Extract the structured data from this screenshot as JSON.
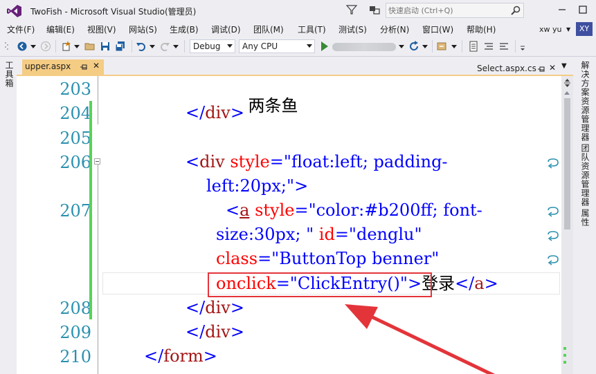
{
  "window": {
    "title": "TwoFish - Microsoft Visual Studio(管理员)",
    "quick_launch_placeholder": "快速启动 (Ctrl+Q)",
    "user": "xw yu",
    "avatar": "XY"
  },
  "menu": [
    "文件(F)",
    "编辑(E)",
    "视图(V)",
    "网站(S)",
    "生成(B)",
    "调试(D)",
    "团队(M)",
    "工具(T)",
    "测试(S)",
    "分析(N)",
    "窗口(W)",
    "帮助(H)"
  ],
  "toolbar": {
    "config": "Debug",
    "platform": "Any CPU"
  },
  "left_panel": {
    "toolbox_label": "工具箱"
  },
  "right_panel": [
    "解决方案资源管理器",
    "团队资源管理器",
    "属性"
  ],
  "tabs": {
    "active": "upper.aspx",
    "preview": "Select.aspx.cs"
  },
  "editor": {
    "line_numbers": [
      "203",
      "204",
      "205",
      "206",
      "207",
      "208",
      "209",
      "210"
    ],
    "code": {
      "l203": "两条鱼",
      "l204_open": "</",
      "l204_tag": "div",
      "l204_close": ">",
      "l206_open": "<",
      "l206_tag": "div",
      "l206_attr": "style",
      "l206_eq": "=",
      "l206_val": "\"float:left; padding-",
      "l206b_val": "left:20px;\"",
      "l206b_close": ">",
      "l207_open": "<",
      "l207_tag": "a",
      "l207_attr": "style",
      "l207_eq": "=",
      "l207_val": "\"color:#b200ff; font-",
      "l207b_val": "size:30px; \"",
      "l207b_attr": "id",
      "l207b_eq": "=",
      "l207b_val2": "\"denglu\"",
      "l207c_attr": "class",
      "l207c_eq": "=",
      "l207c_val": "\"ButtonTop benner\"",
      "l207d_attr": "onclick",
      "l207d_eq": "=",
      "l207d_val": "\"ClickEntry()\"",
      "l207d_close": ">",
      "l207d_text": "登录",
      "l207d_etag_open": "</",
      "l207d_etag": "a",
      "l207d_etag_close": ">",
      "l208_open": "</",
      "l208_tag": "div",
      "l208_close": ">",
      "l209_open": "</",
      "l209_tag": "div",
      "l209_close": ">",
      "l210_open": "</",
      "l210_tag": "form",
      "l210_close": ">"
    }
  },
  "colors": {
    "line_number": "#2B91AF",
    "tag": "#A31515",
    "attribute": "#FF0000",
    "value": "#0000FF",
    "tab_active": "#F5CC84",
    "annotation": "#E3343A",
    "change_bar": "#57D357"
  }
}
